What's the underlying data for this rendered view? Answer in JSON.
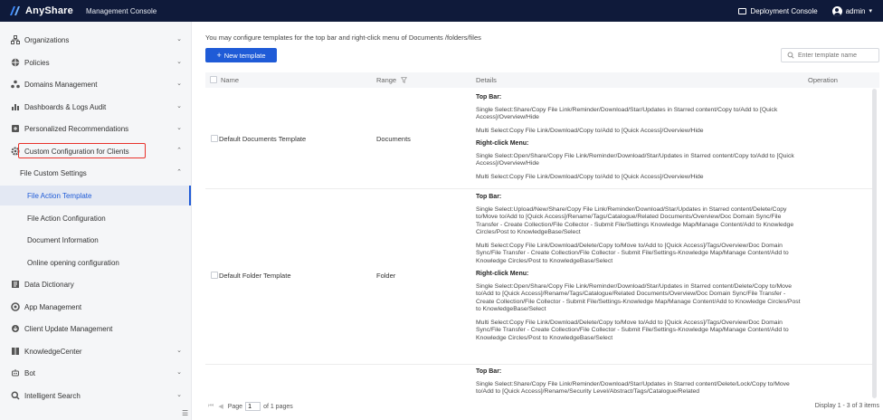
{
  "topbar": {
    "brand": "AnyShare",
    "console_title": "Management Console",
    "deployment_console": "Deployment Console",
    "user": "admin"
  },
  "sidebar": {
    "items": [
      {
        "label": "Organizations",
        "icon": "org-icon"
      },
      {
        "label": "Policies",
        "icon": "policy-icon"
      },
      {
        "label": "Domains Management",
        "icon": "domain-icon"
      },
      {
        "label": "Dashboards & Logs Audit",
        "icon": "chart-icon"
      },
      {
        "label": "Personalized Recommendations",
        "icon": "recommend-icon"
      },
      {
        "label": "Custom Configuration for Clients",
        "icon": "gear-icon"
      },
      {
        "label": "File Custom Settings"
      },
      {
        "label": "File Action Template"
      },
      {
        "label": "File Action Configuration"
      },
      {
        "label": "Document Information"
      },
      {
        "label": "Online opening configuration"
      },
      {
        "label": "Data Dictionary",
        "icon": "dictionary-icon"
      },
      {
        "label": "App Management",
        "icon": "app-icon"
      },
      {
        "label": "Client Update Management",
        "icon": "update-icon"
      },
      {
        "label": "KnowledgeCenter",
        "icon": "book-icon"
      },
      {
        "label": "Bot",
        "icon": "bot-icon"
      },
      {
        "label": "Intelligent Search",
        "icon": "search-icon"
      }
    ]
  },
  "main": {
    "intro": "You may configure templates for the top bar and right-click menu of Documents /folders/files",
    "new_template": "New template",
    "search_placeholder": "Enter template name",
    "columns": {
      "name": "Name",
      "range": "Range",
      "details": "Details",
      "operation": "Operation"
    },
    "rows": [
      {
        "name": "Default Documents Template",
        "range": "Documents",
        "top_bar": "Top Bar:",
        "top_single": "Single Select:Share/Copy File Link/Reminder/Download/Star/Updates in Starred content/Copy to/Add to [Quick Access]/Overview/Hide",
        "top_multi": "Multi Select:Copy File Link/Download/Copy to/Add to [Quick Access]/Overview/Hide",
        "right_menu": "Right-click Menu:",
        "right_single": "Single Select:Open/Share/Copy File Link/Reminder/Download/Star/Updates in Starred content/Copy to/Add to [Quick Access]/Overview/Hide",
        "right_multi": "Multi Select:Copy File Link/Download/Copy to/Add to [Quick Access]/Overview/Hide"
      },
      {
        "name": "Default Folder Template",
        "range": "Folder",
        "top_bar": "Top Bar:",
        "top_single": "Single Select:Upload/New/Share/Copy File Link/Reminder/Download/Star/Updates in Starred content/Delete/Copy to/Move to/Add to [Quick Access]/Rename/Tags/Catalogue/Related Documents/Overview/Doc Domain Sync/File Transfer - Create Collection/File Collector - Submit File/Settings Knowledge Map/Manage Content/Add to Knowledge Circles/Post to KnowledgeBase/Select",
        "top_multi": "Multi Select:Copy File Link/Download/Delete/Copy to/Move to/Add to [Quick Access]/Tags/Overview/Doc Domain Sync/File Transfer - Create Collection/File Collector - Submit File/Settings-Knowledge Map/Manage Content/Add to Knowledge Circles/Post to KnowledgeBase/Select",
        "right_menu": "Right-click Menu:",
        "right_single": "Single Select:Open/Share/Copy File Link/Reminder/Download/Star/Updates in Starred content/Delete/Copy to/Move to/Add to [Quick Access]/Rename/Tags/Catalogue/Related Documents/Overview/Doc Domain Sync/File Transfer - Create Collection/File Collector - Submit File/Settings-Knowledge Map/Manage Content/Add to Knowledge Circles/Post to KnowledgeBase/Select",
        "right_multi": "Multi Select:Copy File Link/Download/Delete/Copy to/Move to/Add to [Quick Access]/Tags/Overview/Doc Domain Sync/File Transfer - Create Collection/File Collector - Submit File/Settings-Knowledge Map/Manage Content/Add to Knowledge Circles/Post to KnowledgeBase/Select"
      },
      {
        "top_bar": "Top Bar:",
        "top_single": "Single Select:Share/Copy File Link/Reminder/Download/Star/Updates in Starred content/Delete/Lock/Copy to/Move to/Add to [Quick Access]/Rename/Security Level/Abstract/Tags/Catalogue/Related"
      }
    ],
    "pager": {
      "page_label": "Page",
      "page_value": "1",
      "of_pages": "of 1 pages",
      "display": "Display 1 - 3 of 3 items"
    }
  }
}
